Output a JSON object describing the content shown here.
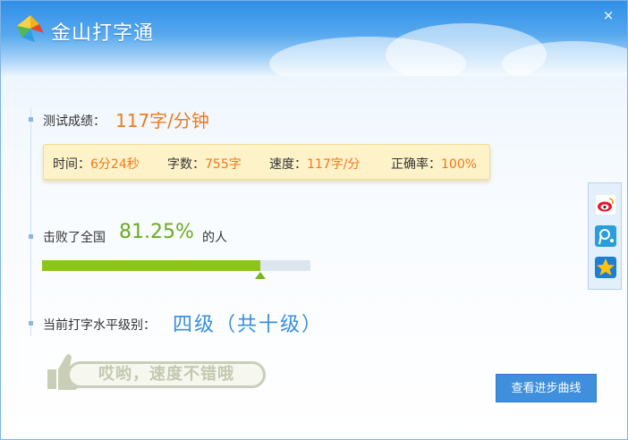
{
  "window": {
    "title": "金山打字通",
    "close_label": "×"
  },
  "result": {
    "score_label": "测试成绩：",
    "score_value": "117字/分钟",
    "stats": [
      {
        "key": "时间：",
        "value": "6分24秒"
      },
      {
        "key": "字数：",
        "value": "755字"
      },
      {
        "key": "速度：",
        "value": "117字/分"
      },
      {
        "key": "正确率：",
        "value": "100%"
      }
    ],
    "beat_label": "击败了全国",
    "beat_value": "81.25%",
    "beat_suffix": "的人",
    "beat_fraction": 0.8125,
    "level_label": "当前打字水平级别：",
    "level_value": "四级（共十级）",
    "stamp_text": "哎哟，速度不错哦"
  },
  "actions": {
    "view_curve_label": "查看进步曲线"
  },
  "share": {
    "icons": [
      "weibo-icon",
      "tencent-weibo-icon",
      "qzone-icon"
    ]
  },
  "colors": {
    "accent_orange": "#f07a1d",
    "accent_green": "#6bab1e",
    "accent_blue": "#3b8fdc",
    "title_blue": "#2f8fe6"
  }
}
